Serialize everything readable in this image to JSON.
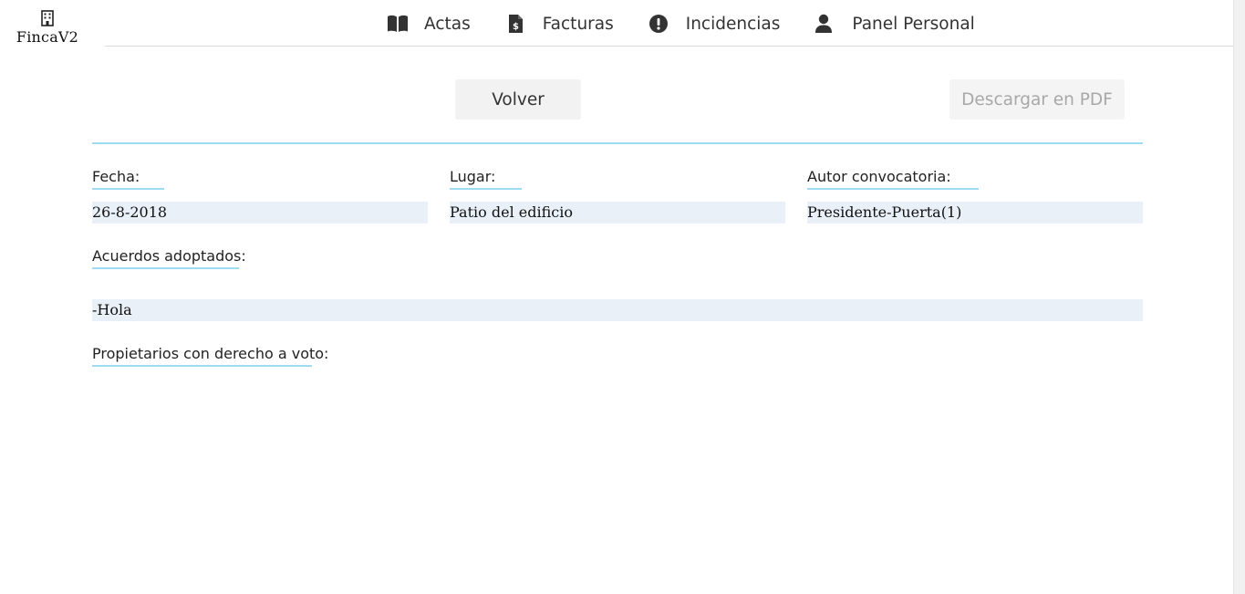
{
  "brand": {
    "name": "FincaV2",
    "icon": "building-icon"
  },
  "nav": {
    "items": [
      {
        "label": "Actas",
        "icon": "book-open-icon"
      },
      {
        "label": "Facturas",
        "icon": "invoice-dollar-icon"
      },
      {
        "label": "Incidencias",
        "icon": "exclamation-circle-icon"
      },
      {
        "label": "Panel Personal",
        "icon": "user-icon"
      }
    ]
  },
  "actions": {
    "back_label": "Volver",
    "pdf_label": "Descargar en PDF"
  },
  "acta": {
    "fecha_label": "Fecha:",
    "fecha_value": "26-8-2018",
    "lugar_label": "Lugar:",
    "lugar_value": "Patio del edificio",
    "autor_label": "Autor convocatoria:",
    "autor_value": "Presidente-Puerta(1)",
    "acuerdos_label": "Acuerdos adoptados:",
    "acuerdos_value": "-Hola",
    "propietarios_label": "Propietarios con derecho a voto:"
  },
  "colors": {
    "accent": "#9fdcf2",
    "value_bg": "#e9f0f8",
    "button_bg": "#f2f2f2",
    "disabled_text": "#a8a8a8"
  }
}
